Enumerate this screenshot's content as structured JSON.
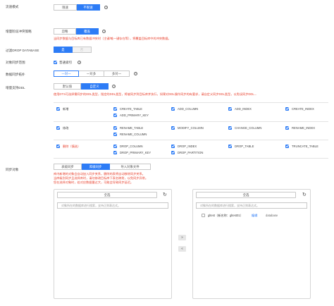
{
  "flow_mode": {
    "label": "流速模式",
    "options": [
      "限速",
      "不限速"
    ],
    "selected_index": 1
  },
  "incremental_conflict": {
    "label": "增量阶段冲突策略",
    "options": [
      "忽略",
      "覆盖"
    ],
    "selected_index": 1,
    "warning": "当同步数据与目标库已有数据冲突时（主键/唯一键存在等），将覆盖目标库中的冲突数据。"
  },
  "filter_drop": {
    "label": "过滤DROP DATABASE",
    "options": [
      "是",
      "否"
    ],
    "selected_index": 0
  },
  "object_scope": {
    "label": "对象同步范围",
    "checkbox_label": "普通索引",
    "checked": true
  },
  "data_sync_topology": {
    "label": "数据同步拓扑",
    "options": [
      "一对一",
      "一对多",
      "多对一"
    ],
    "selected_index": 0
  },
  "incremental_ddl": {
    "label": "增量支持DDL",
    "options": [
      "默认值",
      "自定义"
    ],
    "selected_index": 1,
    "warning": "使用DTS可选择需同步的DDL类型，指定的DDL类型，将被同步到目标库并执行，如果对DDL操作同步的有要求，请自定义同步DDL类型，以免误同步DDL...",
    "groups": [
      {
        "name": "新增",
        "danger": false,
        "items": [
          "CREATE_TABLE",
          "ADD_COLUMN",
          "ADD_INDEX",
          "CREATE_INDEX",
          "ADD_PRIMARY_KEY"
        ]
      },
      {
        "name": "修改",
        "danger": false,
        "items": [
          "RENAME_TABLE",
          "MODIFY_COLUMN",
          "CHANGE_COLUMN",
          "RENAME_INDEX",
          "RENAME_COLUMN"
        ]
      },
      {
        "name": "删除（慎选）",
        "danger": true,
        "items": [
          "DROP_COLUMN",
          "DROP_INDEX",
          "DROP_TABLE",
          "TRUNCATE_TABLE",
          "DROP_PRIMARY_KEY",
          "DROP_PARTITION"
        ]
      }
    ]
  },
  "sync_objects": {
    "label": "同步对象",
    "options": [
      "表级同步",
      "库级同步",
      "导入对象文件"
    ],
    "selected_index": 1,
    "warnings": [
      "库内新增的对象会自动加入同步关系，删除的表将自动移除同步关系。",
      "当库级别同步且选择库时，请勿修改目标库下表名映射，以免同步异常。",
      "您在选择对象时，若对应数据量过大，可能会导致同步延迟。"
    ],
    "left_panel": {
      "title": "全选",
      "search_placeholder": "对象所在的数据库进行搜索，支持正则表达式。"
    },
    "right_panel": {
      "title": "全选",
      "search_placeholder": "对象所在的数据库进行搜索，支持正则表达式。",
      "item_name": "gltest（新名称：gltest01）",
      "item_edit": "编辑",
      "item_type": "database"
    },
    "move_right": "»",
    "move_left": "«"
  },
  "help_glyph": "?",
  "refresh_glyph": "↻"
}
